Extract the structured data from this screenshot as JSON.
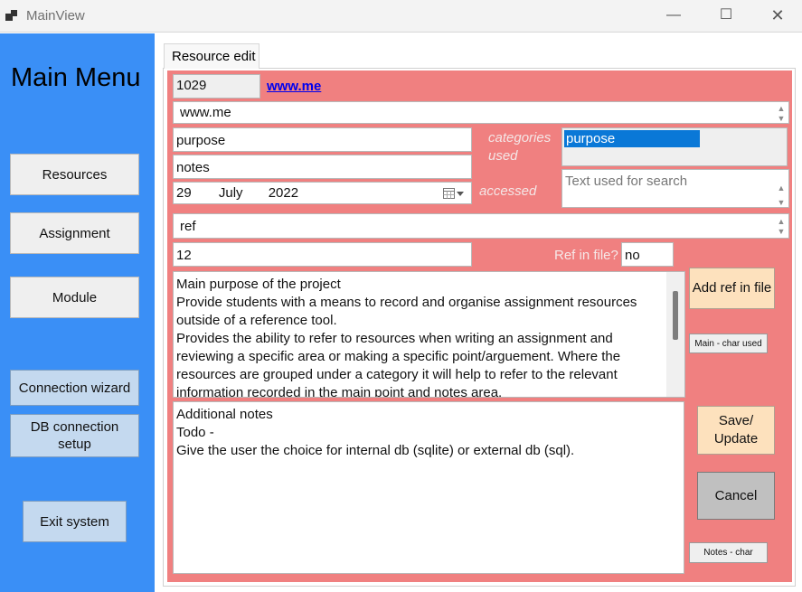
{
  "window": {
    "title": "MainView",
    "minimize": "—",
    "maximize": "☐",
    "close": "✕"
  },
  "sidebar": {
    "title": "Main Menu",
    "buttons": {
      "resources": "Resources",
      "assignment": "Assignment",
      "module": "Module",
      "connection_wizard": "Connection wizard",
      "db_setup": "DB connection setup",
      "exit": "Exit system"
    }
  },
  "tab": {
    "label": "Resource edit"
  },
  "form": {
    "id": "1029",
    "link": "www.me",
    "url": "www.me",
    "purpose": "purpose",
    "notes": "notes",
    "date": {
      "day": "29",
      "month": "July",
      "year": "2022"
    },
    "ref": "ref",
    "number": "12",
    "categories_label": "categories used",
    "accessed_label": "accessed",
    "ref_in_file_label": "Ref in file?",
    "ref_in_file_value": "no",
    "categories_selected": "purpose",
    "search_placeholder": "Text used for search",
    "main_text": [
      "Main purpose of the project",
      "Provide students with a means to record and organise assignment resources",
      "outside of a reference tool.",
      "Provides the ability to refer to resources when writing an assignment and",
      "reviewing a specific area or making a specific point/arguement. Where the",
      "resources are grouped under a category it will help to refer to the relevant",
      "information recorded in the main point and notes area."
    ],
    "notes_text": [
      "Additional notes",
      "Todo -",
      "Give the user the choice for internal db (sqlite) or external db (sql)."
    ]
  },
  "actions": {
    "add_ref": "Add ref in file",
    "main_char": "Main - char used",
    "save": "Save/ Update",
    "cancel": "Cancel",
    "notes_char": "Notes - char"
  },
  "colors": {
    "sidebar": "#3a8ff6",
    "panel": "#f08080",
    "peach_button": "#fde1bd",
    "selection": "#0a78d7"
  }
}
